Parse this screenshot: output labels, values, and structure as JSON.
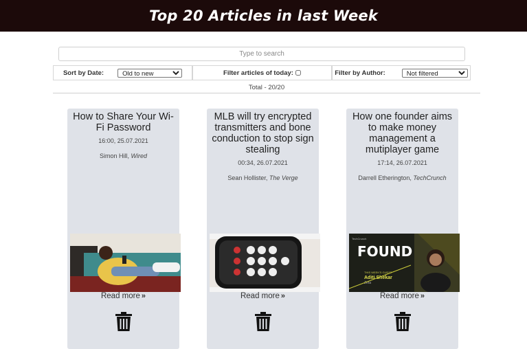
{
  "header": {
    "title": "Top 20 Articles in last Week"
  },
  "search": {
    "placeholder": "Type to search"
  },
  "filters": {
    "sort_label": "Sort by Date:",
    "sort_value": "Old to new",
    "today_label": "Filter articles of today:",
    "author_label": "Filter by Author:",
    "author_value": "Not filtered"
  },
  "total": "Total - 20/20",
  "colors": {
    "header_bg": "#1c0a0a",
    "card_bg": "#dfe2e8"
  },
  "articles": [
    {
      "title": "How to Share Your Wi-Fi Password",
      "datetime": "16:00, 25.07.2021",
      "author": "Simon Hill,",
      "source": "Wired",
      "read_more": "Read more",
      "image": "person-on-couch-with-phone"
    },
    {
      "title": "MLB will try encrypted transmitters and bone conduction to stop sign stealing",
      "datetime": "00:34, 26.07.2021",
      "author": "Sean Hollister,",
      "source": "The Verge",
      "read_more": "Read more",
      "image": "keypad-transmitter"
    },
    {
      "title": "How one founder aims to make money management a mutiplayer game",
      "datetime": "17:14, 26.07.2021",
      "author": "Darrell Etherington,",
      "source": "TechCrunch",
      "read_more": "Read more",
      "image": "found-podcast-banner",
      "image_text": {
        "brand": "TechCrunch",
        "found": "FOUND",
        "guest_line": "THIS WEEK'S GUEST",
        "guest": "Aditi Shekar",
        "company": "Zeta"
      }
    }
  ]
}
